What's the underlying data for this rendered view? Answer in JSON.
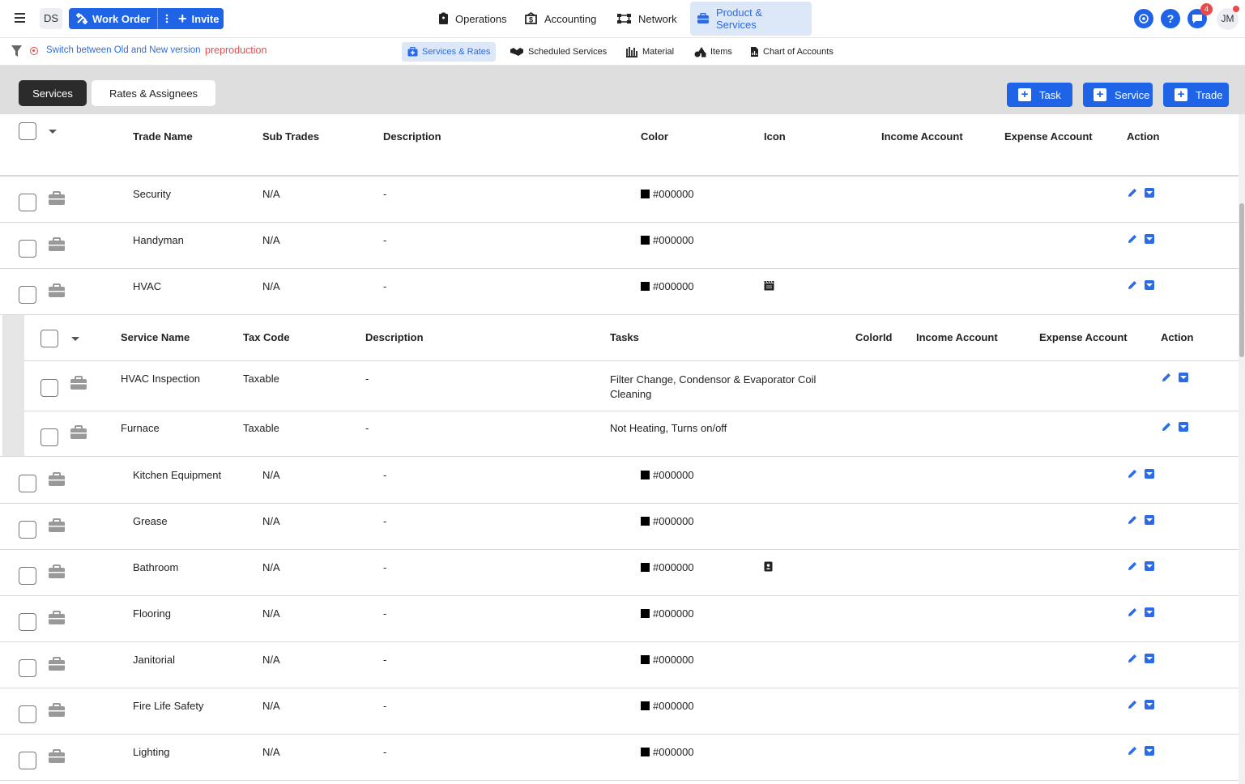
{
  "topbar": {
    "ds_label": "DS",
    "work_order_label": "Work Order",
    "invite_label": "Invite",
    "nav": [
      {
        "label": "Operations",
        "icon": "clipboard-icon"
      },
      {
        "label": "Accounting",
        "icon": "dollar-icon"
      },
      {
        "label": "Network",
        "icon": "network-icon"
      },
      {
        "label": "Product & Services",
        "icon": "briefcase-icon",
        "active": true
      }
    ],
    "notification_count": "4",
    "avatar_initials": "JM"
  },
  "subbar": {
    "switch_link": "Switch between Old and New version",
    "environment": "preproduction",
    "tabs": [
      {
        "label": "Services & Rates",
        "active": true
      },
      {
        "label": "Scheduled Services"
      },
      {
        "label": "Material"
      },
      {
        "label": "Items"
      },
      {
        "label": "Chart of Accounts"
      }
    ]
  },
  "toolbar": {
    "segments": [
      "Services",
      "Rates & Assignees"
    ],
    "task_label": "Task",
    "service_label": "Service",
    "trade_label": "Trade"
  },
  "table": {
    "headers": [
      "Trade Name",
      "Sub Trades",
      "Description",
      "Color",
      "Icon",
      "Income Account",
      "Expense Account",
      "Action"
    ],
    "rows_top": [
      {
        "name": "Security",
        "sub": "N/A",
        "desc": "-",
        "color": "#000000",
        "icon": ""
      },
      {
        "name": "Handyman",
        "sub": "N/A",
        "desc": "-",
        "color": "#000000",
        "icon": ""
      },
      {
        "name": "HVAC",
        "sub": "N/A",
        "desc": "-",
        "color": "#000000",
        "icon": "film-icon"
      }
    ],
    "rows_bottom": [
      {
        "name": "Kitchen Equipment",
        "sub": "N/A",
        "desc": "-",
        "color": "#000000",
        "icon": ""
      },
      {
        "name": "Grease",
        "sub": "N/A",
        "desc": "-",
        "color": "#000000",
        "icon": ""
      },
      {
        "name": "Bathroom",
        "sub": "N/A",
        "desc": "-",
        "color": "#000000",
        "icon": "contact-card-icon"
      },
      {
        "name": "Flooring",
        "sub": "N/A",
        "desc": "-",
        "color": "#000000",
        "icon": ""
      },
      {
        "name": "Janitorial",
        "sub": "N/A",
        "desc": "-",
        "color": "#000000",
        "icon": ""
      },
      {
        "name": "Fire Life Safety",
        "sub": "N/A",
        "desc": "-",
        "color": "#000000",
        "icon": ""
      },
      {
        "name": "Lighting",
        "sub": "N/A",
        "desc": "-",
        "color": "#000000",
        "icon": ""
      }
    ]
  },
  "subtable": {
    "headers": [
      "Service Name",
      "Tax Code",
      "Description",
      "Tasks",
      "ColorId",
      "Income Account",
      "Expense Account",
      "Action"
    ],
    "rows": [
      {
        "name": "HVAC Inspection",
        "tax": "Taxable",
        "desc": "-",
        "tasks": "Filter Change, Condensor & Evaporator Coil Cleaning"
      },
      {
        "name": "Furnace",
        "tax": "Taxable",
        "desc": "-",
        "tasks": "Not Heating, Turns on/off"
      }
    ]
  }
}
